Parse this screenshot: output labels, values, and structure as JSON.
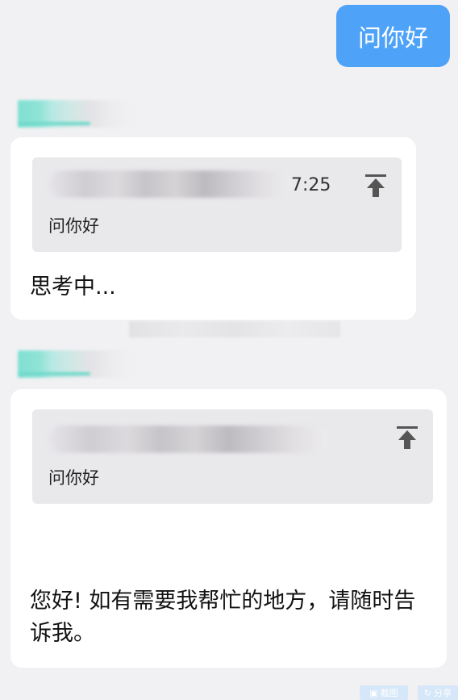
{
  "user_message": {
    "text": "问你好"
  },
  "messages": [
    {
      "quote": {
        "time": "7:25",
        "text": "问你好"
      },
      "status": "思考中..."
    },
    {
      "quote": {
        "text": "问你好"
      },
      "reply": "您好! 如有需要我帮忙的地方，请随时告诉我。"
    }
  ],
  "footer": {
    "left_label": "截图",
    "right_label": "分享"
  },
  "colors": {
    "user_bubble": "#4ea3f9",
    "card": "#ffffff",
    "quote_bg": "#e9e9ec",
    "page_bg": "#f1f1f3"
  }
}
